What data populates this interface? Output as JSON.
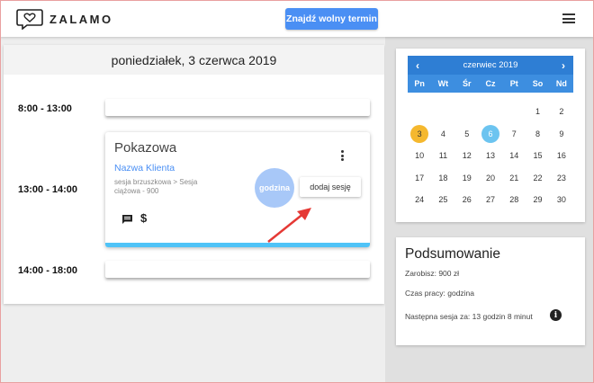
{
  "app": {
    "brand": "ZALAMO",
    "cta_label": "Znajdź wolny termin"
  },
  "schedule": {
    "date_title": "poniedziałek, 3 czerwca 2019",
    "slots": [
      {
        "time": "8:00 - 13:00"
      },
      {
        "time": "13:00 - 14:00"
      },
      {
        "time": "14:00 - 18:00"
      }
    ],
    "session": {
      "title": "Pokazowa",
      "client": "Nazwa Klienta",
      "description": "sesja brzuszkowa > Sesja ciążowa - 900",
      "hour_badge": "godzina",
      "add_label": "dodaj sesję",
      "icons": [
        "chat-icon",
        "dollar-icon",
        "more-vert-icon"
      ],
      "stripe_color": "#4fc3f7"
    }
  },
  "calendar": {
    "month_label": "czerwiec 2019",
    "prev_icon": "chevron-left-icon",
    "next_icon": "chevron-right-icon",
    "weekdays": [
      "Pn",
      "Wt",
      "Śr",
      "Cz",
      "Pt",
      "So",
      "Nd"
    ],
    "leading_blanks": 5,
    "days": [
      "1",
      "2",
      "3",
      "4",
      "5",
      "6",
      "7",
      "8",
      "9",
      "10",
      "11",
      "12",
      "13",
      "14",
      "15",
      "16",
      "17",
      "18",
      "19",
      "20",
      "21",
      "22",
      "23",
      "24",
      "25",
      "26",
      "27",
      "28",
      "29",
      "30"
    ],
    "selected_day": "3",
    "today_day": "6",
    "colors": {
      "header": "#2e7ed4",
      "selected": "#f5b82e",
      "today": "#6cc4f0"
    }
  },
  "summary": {
    "title": "Podsumowanie",
    "earnings": "Zarobisz: 900 zł",
    "work_time": "Czas pracy: godzina",
    "next_session": "Następna sesja za: 13 godzin 8 minut",
    "info_icon": "info-icon"
  }
}
